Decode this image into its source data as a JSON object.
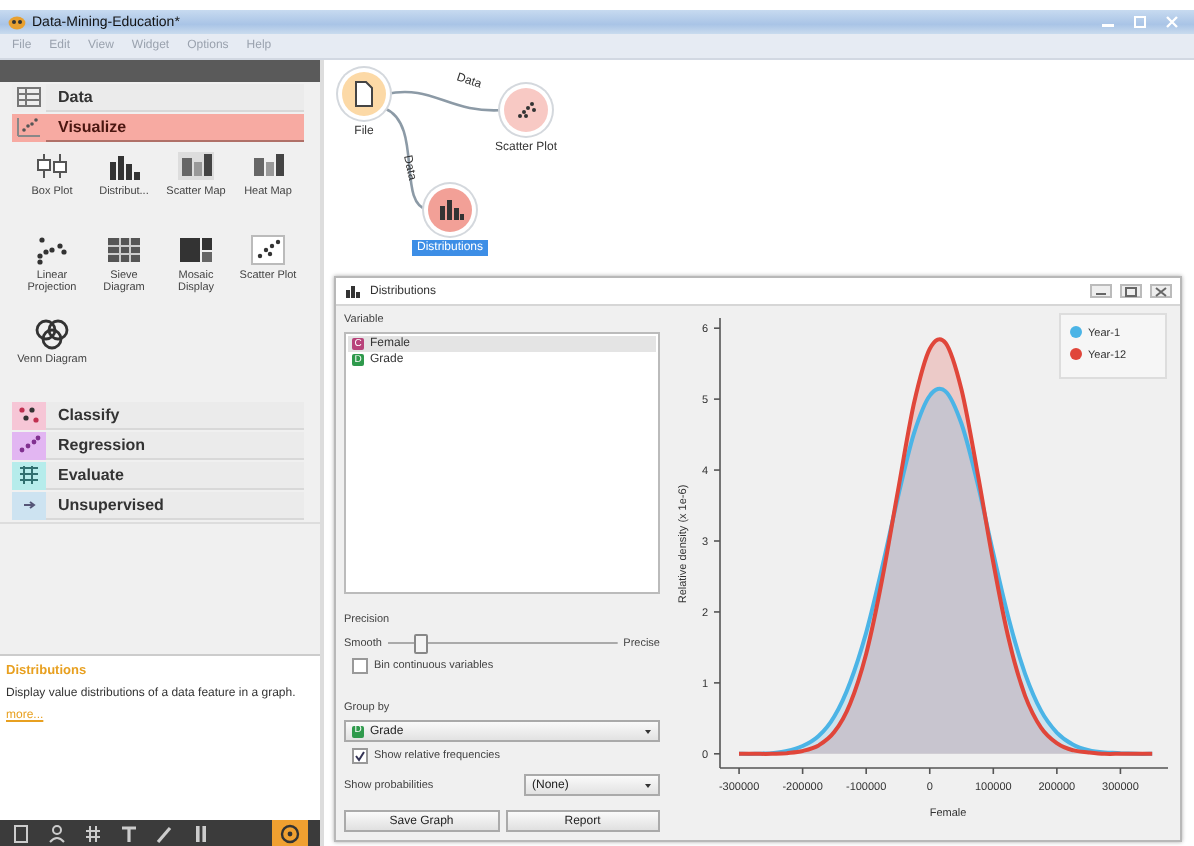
{
  "window": {
    "title": "Data-Mining-Education*"
  },
  "menu": [
    "File",
    "Edit",
    "View",
    "Widget",
    "Options",
    "Help"
  ],
  "toolbox": {
    "categories": [
      {
        "label": "Data",
        "color": "#eeeeee",
        "expanded": false
      },
      {
        "label": "Visualize",
        "color": "#f7aaa2",
        "expanded": true,
        "widgets": [
          "Box Plot",
          "Distribut...",
          "Scatter Map",
          "Heat Map",
          "Linear Projection",
          "Sieve Diagram",
          "Mosaic Display",
          "Scatter Plot",
          "Venn Diagram"
        ]
      },
      {
        "label": "Classify",
        "color": "#f6c6d6",
        "expanded": false
      },
      {
        "label": "Regression",
        "color": "#e2b6f2",
        "expanded": false
      },
      {
        "label": "Evaluate",
        "color": "#b6eceb",
        "expanded": false
      },
      {
        "label": "Unsupervised",
        "color": "#cde3f1",
        "expanded": false
      }
    ]
  },
  "description": {
    "title": "Distributions",
    "text": "Display value distributions of a data feature in a graph.",
    "link": "more..."
  },
  "canvas": {
    "links": [
      {
        "label": "Data"
      },
      {
        "label": "Data"
      }
    ],
    "nodes": [
      {
        "label": "File",
        "color": "#fcd9a6",
        "selected": false
      },
      {
        "label": "Scatter Plot",
        "color": "#f8c9c4",
        "selected": false
      },
      {
        "label": "Distributions",
        "color": "#f2a097",
        "selected": true
      }
    ]
  },
  "distributions": {
    "title": "Distributions",
    "variable_label": "Variable",
    "variables": [
      {
        "name": "Female",
        "badge": "C",
        "color": "#b8437a",
        "selected": true
      },
      {
        "name": "Grade",
        "badge": "D",
        "color": "#2f9a4c",
        "selected": false
      }
    ],
    "precision": {
      "label": "Precision",
      "min_label": "Smooth",
      "max_label": "Precise",
      "level": 0.12
    },
    "bin_continuous": {
      "label": "Bin continuous variables",
      "checked": false
    },
    "group_by": {
      "label": "Group by",
      "value": "Grade",
      "badge": "D",
      "color": "#2f9a4c"
    },
    "relative_frequencies": {
      "label": "Show relative frequencies",
      "checked": true
    },
    "probabilities": {
      "label": "Show probabilities",
      "value": "(None)"
    },
    "buttons": [
      "Save Graph",
      "Report"
    ],
    "chart_data": {
      "type": "area",
      "xlabel": "Female",
      "ylabel": "Relative density (x 1e-6)",
      "x": [
        -300000,
        -275000,
        -250000,
        -225000,
        -200000,
        -175000,
        -150000,
        -125000,
        -100000,
        -75000,
        -50000,
        -25000,
        0,
        25000,
        50000,
        75000,
        100000,
        125000,
        150000,
        175000,
        200000,
        225000,
        250000,
        275000,
        300000,
        325000,
        350000
      ],
      "series": [
        {
          "name": "Year-1",
          "color": "#4bb4e6",
          "values": [
            0.0,
            0.0,
            0.01,
            0.04,
            0.11,
            0.25,
            0.53,
            1.01,
            1.71,
            2.62,
            3.62,
            4.51,
            5.05,
            5.11,
            4.65,
            3.82,
            2.82,
            1.88,
            1.13,
            0.61,
            0.3,
            0.13,
            0.05,
            0.02,
            0.01,
            0.0,
            0.0
          ]
        },
        {
          "name": "Year-12",
          "color": "#e0463a",
          "values": [
            0.0,
            0.0,
            0.0,
            0.01,
            0.04,
            0.12,
            0.31,
            0.71,
            1.41,
            2.45,
            3.71,
            4.93,
            5.71,
            5.79,
            5.13,
            3.97,
            2.69,
            1.59,
            0.82,
            0.37,
            0.15,
            0.05,
            0.02,
            0.0,
            0.0,
            0.0,
            0.0
          ]
        }
      ],
      "xlim": [
        -330000,
        378000
      ],
      "ylim": [
        -0.2,
        6.2
      ],
      "legend": "top-right",
      "xticks": [
        -300000,
        -200000,
        -100000,
        0,
        100000,
        200000,
        300000
      ],
      "yticks": [
        0,
        1,
        2,
        3,
        4,
        5,
        6
      ]
    }
  }
}
